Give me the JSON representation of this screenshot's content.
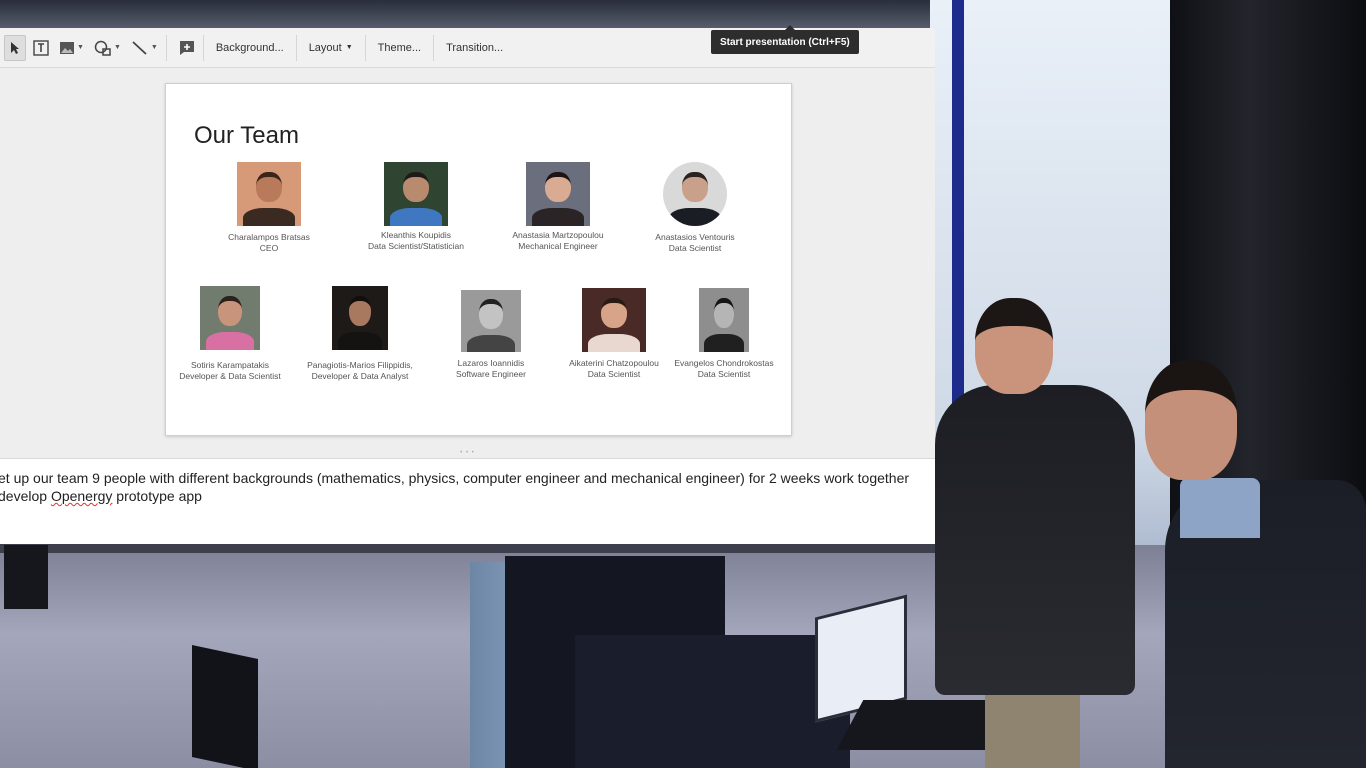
{
  "toolbar": {
    "icons": [
      "select-pointer-icon",
      "text-box-icon",
      "image-icon",
      "shape-icon",
      "line-icon",
      "add-comment-icon"
    ],
    "background_label": "Background...",
    "layout_label": "Layout",
    "theme_label": "Theme...",
    "transition_label": "Transition..."
  },
  "tooltip": {
    "text": "Start presentation (Ctrl+F5)"
  },
  "slide": {
    "title": "Our Team",
    "members": [
      {
        "name": "Charalampos Bratsas",
        "role": "CEO",
        "bg": "#d79a78",
        "skin": "#b97a5c",
        "shirt": "#3a2a22",
        "hair": "#3b2418"
      },
      {
        "name": "Kleanthis Koupidis",
        "role": "Data Scientist/Statistician",
        "bg": "#2f4532",
        "skin": "#b88a6e",
        "shirt": "#3f78c0",
        "hair": "#1f1a17"
      },
      {
        "name": "Anastasia Martzopoulou",
        "role": "Mechanical Engineer",
        "bg": "#6b6f7d",
        "skin": "#d9ab92",
        "shirt": "#2a2426",
        "hair": "#1c1416"
      },
      {
        "name": "Anastasios Ventouris",
        "role": "Data Scientist",
        "bg": "#d9d9d9",
        "skin": "#c9a08a",
        "shirt": "#1b1d24",
        "hair": "#2a2220"
      },
      {
        "name": "Sotiris Karampatakis",
        "role": "Developer & Data Scientist",
        "bg": "#717c6f",
        "skin": "#c8947c",
        "shirt": "#d970a4",
        "hair": "#2b211d"
      },
      {
        "name": "Panagiotis-Marios Filippidis,",
        "role": "Developer & Data Analyst",
        "bg": "#1d1a17",
        "skin": "#a9795f",
        "shirt": "#151312",
        "hair": "#120e0c"
      },
      {
        "name": "Lazaros Ioannidis",
        "role": "Software Engineer",
        "bg": "#9a9a9a",
        "skin": "#c3c3c3",
        "shirt": "#444444",
        "hair": "#222222"
      },
      {
        "name": "Aikaterini Chatzopoulou",
        "role": "Data Scientist",
        "bg": "#4a2a26",
        "skin": "#d7a48a",
        "shirt": "#e8d8d0",
        "hair": "#2a1a16"
      },
      {
        "name": "Evangelos Chondrokostas",
        "role": "Data Scientist",
        "bg": "#8e8e8e",
        "skin": "#b5b5b5",
        "shirt": "#202020",
        "hair": "#151515"
      }
    ]
  },
  "notes": {
    "line1": "et up our team 9 people with different backgrounds (mathematics, physics, computer engineer and mechanical engineer) for 2 weeks work together",
    "line2_prefix": " develop ",
    "line2_word": "Openergy",
    "line2_suffix": " prototype app"
  }
}
